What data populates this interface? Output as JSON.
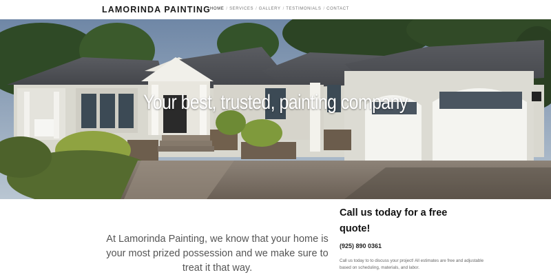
{
  "header": {
    "logo": "LAMORINDA PAINTING",
    "nav": [
      "HOME",
      "SERVICES",
      "GALLERY",
      "TESTIMONIALS",
      "CONTACT"
    ],
    "separator": "/"
  },
  "hero": {
    "title": "Your best, trusted, painting company"
  },
  "main": {
    "intro": "At Lamorinda Painting, we know that your home is your most prized possession and we make sure to treat it that way."
  },
  "cta": {
    "heading": "Call us today for a free quote!",
    "phone": "(925) 890 0361",
    "body": "Call us today to to discuss your project! All estimates are free and adjustable based on scheduling, materials, and labor."
  },
  "colors": {
    "nav_active": "#222222",
    "nav_inactive": "#777777",
    "hero_text": "#ffffff"
  }
}
